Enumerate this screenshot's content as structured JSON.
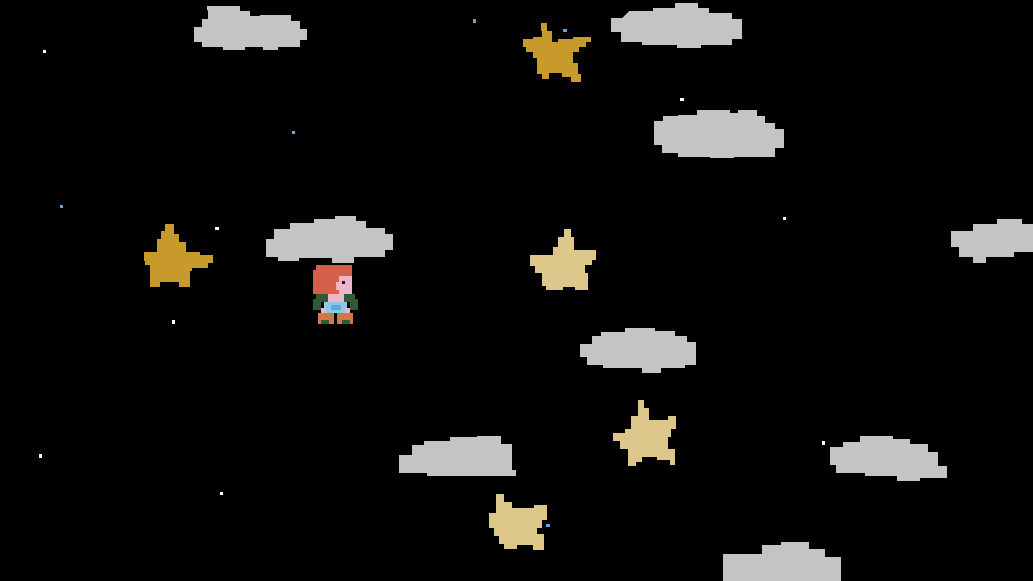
{
  "scene": {
    "background": "#000000",
    "palette": {
      "cloud": "#c4c4c4",
      "star_gold": "#c89a2c",
      "star_pale": "#dcc68a",
      "twinkle_white": "#ffffff",
      "twinkle_blue": "#5ea8dc",
      "hair": "#d4604a",
      "skin": "#f0b4c8",
      "tunic": "#2e5a3a",
      "shirt": "#8cc8e8",
      "boots": "#d07848"
    },
    "icons": {
      "player": "red-haired-child-sprite",
      "cloud": "pixel-cloud",
      "star": "five-point-star",
      "twinkle": "sparkle-dot"
    }
  }
}
